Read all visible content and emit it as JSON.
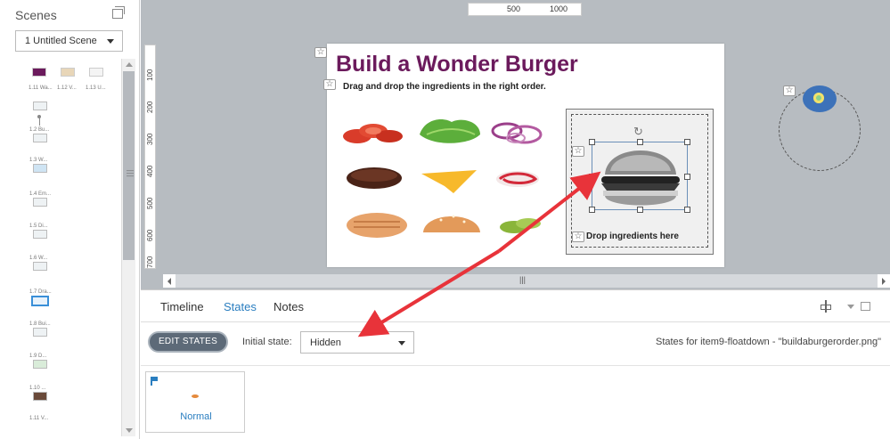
{
  "sidebar": {
    "title": "Scenes",
    "scene_select": "1 Untitled Scene",
    "top_thumbs": [
      "1.11 Wa...",
      "1.12 V...",
      "1.13 U..."
    ],
    "thumbs": [
      "1.2 Bu...",
      "1.3 W...",
      "1.4 Em...",
      "1.5 Di...",
      "1.6 W...",
      "1.7 Dra...",
      "1.8 Bui...",
      "1.9 D...",
      "1.10 ...",
      "1.11 V..."
    ]
  },
  "stage": {
    "hruler": [
      "500",
      "1000"
    ],
    "vruler": [
      "100",
      "200",
      "300",
      "400",
      "500",
      "600",
      "700"
    ],
    "slide_title": "Build a Wonder Burger",
    "slide_subtitle": "Drag and drop the ingredients in the right order.",
    "drop_label": "Drop ingredients here"
  },
  "panel": {
    "tabs": [
      "Timeline",
      "States",
      "Notes"
    ],
    "edit_states": "EDIT STATES",
    "initial_state_label": "Initial state:",
    "initial_state_value": "Hidden",
    "states_for": "States for item9-floatdown - \"buildaburgerorder.png\"",
    "state_name": "Normal"
  },
  "colors": {
    "accent": "#2a7ec0",
    "title": "#6b1a5c",
    "arrow": "#e8333a",
    "stage_bg": "#b7bcc1"
  }
}
